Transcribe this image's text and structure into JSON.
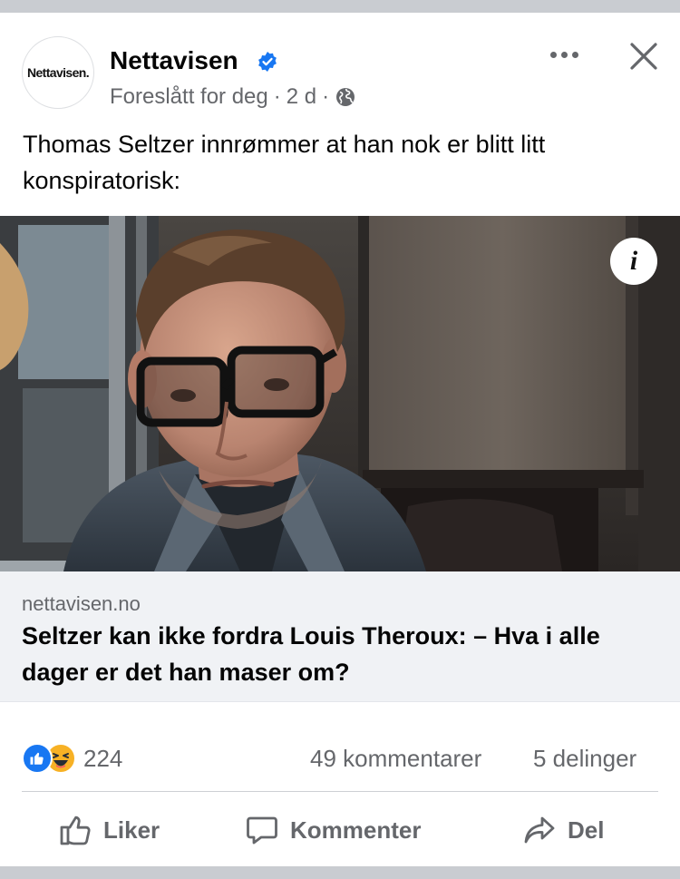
{
  "post": {
    "page_name": "Nettavisen",
    "avatar_text": "Nettavisen.",
    "meta": {
      "suggested": "Foreslått for deg",
      "separator": "·",
      "time": "2 d"
    },
    "text": "Thomas Seltzer innrømmer at han nok er blitt litt konspiratorisk:",
    "photo_info_glyph": "i"
  },
  "link": {
    "domain": "nettavisen.no",
    "title": "Seltzer kan ikke fordra Louis Theroux: – Hva i alle dager er det han maser om?"
  },
  "stats": {
    "reactions_count": "224",
    "comments": "49 kommentarer",
    "shares": "5 delinger",
    "reaction_types": [
      "like",
      "haha"
    ]
  },
  "actions": {
    "like": "Liker",
    "comment": "Kommenter",
    "share": "Del"
  },
  "colors": {
    "brand_blue": "#1877f2",
    "secondary_text": "#65676b",
    "link_bg": "#f0f2f5"
  },
  "icons": {
    "verified": "verified-badge-icon",
    "globe": "globe-icon",
    "more": "more-horizontal-icon",
    "close": "close-icon",
    "info": "info-icon",
    "like": "thumbs-up-icon",
    "comment": "speech-bubble-icon",
    "share": "share-arrow-icon"
  }
}
